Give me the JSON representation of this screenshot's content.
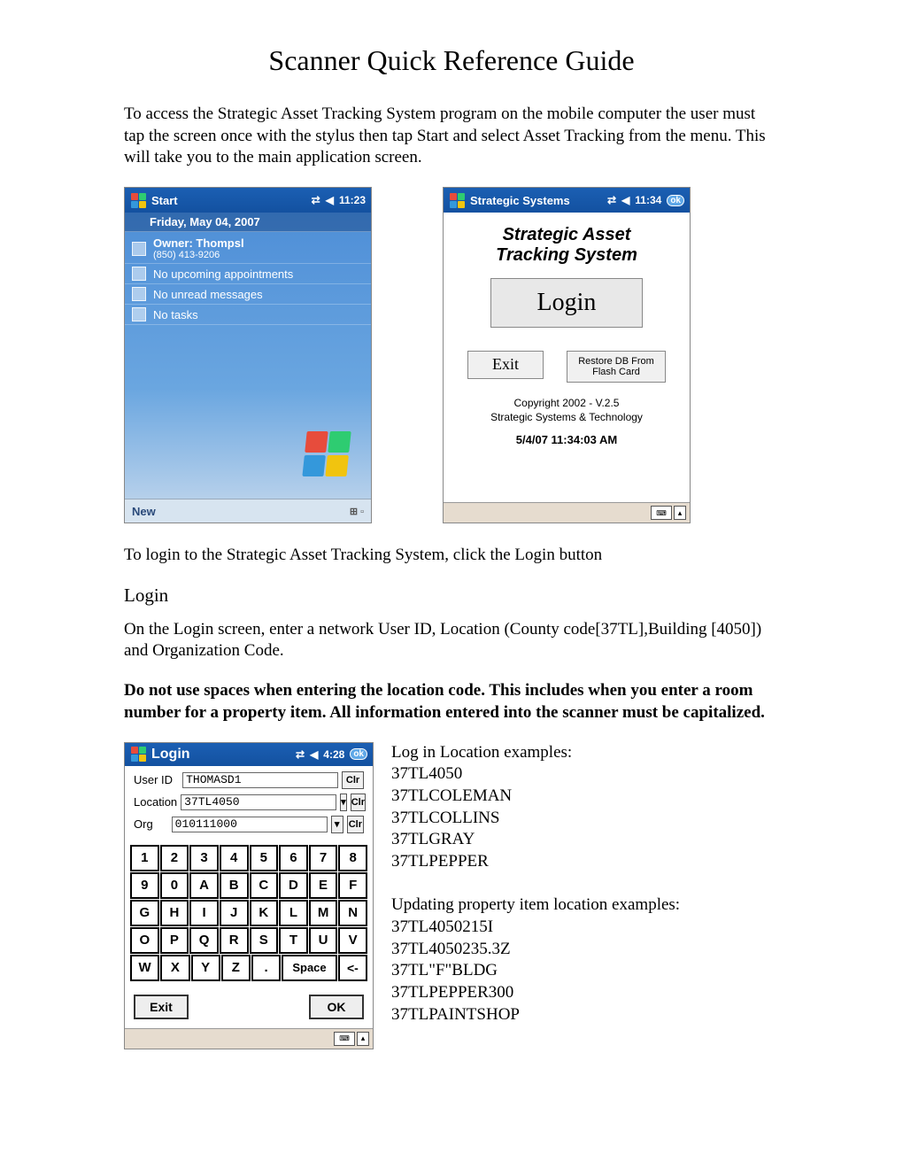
{
  "title": "Scanner Quick Reference Guide",
  "intro": "To access the Strategic Asset Tracking System program on the mobile computer the user must tap the screen once with the stylus then tap Start and select Asset Tracking from the menu.  This will take you to the main application screen.",
  "screenA": {
    "start": "Start",
    "time": "11:23",
    "date": "Friday, May 04, 2007",
    "owner_label": "Owner: Thompsl",
    "owner_phone": "(850) 413-9206",
    "appointments": "No upcoming appointments",
    "messages": "No unread messages",
    "tasks": "No tasks",
    "new": "New"
  },
  "screenB": {
    "title": "Strategic Systems",
    "time": "11:34",
    "ok": "ok",
    "heading1": "Strategic Asset",
    "heading2": "Tracking System",
    "login_btn": "Login",
    "exit_btn": "Exit",
    "restore_btn": "Restore DB From Flash Card",
    "copyright1": "Copyright 2002 - V.2.5",
    "copyright2": "Strategic Systems & Technology",
    "timestamp": "5/4/07 11:34:03 AM"
  },
  "after_screens": "To login to the Strategic Asset Tracking System, click the Login button",
  "login_heading": "Login",
  "login_para": "On the Login screen, enter a network User ID, Location (County code[37TL],Building [4050]) and Organization Code.",
  "bold_para": "Do not use spaces when entering the location code. This includes when you enter a room number for a property item. All information entered into the scanner must be capitalized.",
  "screenC": {
    "title": "Login",
    "time": "4:28",
    "ok": "ok",
    "user_label": "User ID",
    "user_value": "THOMASD1",
    "loc_label": "Location",
    "loc_value": "37TL4050",
    "org_label": "Org",
    "org_value": "010111000",
    "clr": "Clr",
    "keypad": [
      [
        "1",
        "2",
        "3",
        "4",
        "5",
        "6",
        "7",
        "8"
      ],
      [
        "9",
        "0",
        "A",
        "B",
        "C",
        "D",
        "E",
        "F"
      ],
      [
        "G",
        "H",
        "I",
        "J",
        "K",
        "L",
        "M",
        "N"
      ],
      [
        "O",
        "P",
        "Q",
        "R",
        "S",
        "T",
        "U",
        "V"
      ],
      [
        "W",
        "X",
        "Y",
        "Z",
        ".",
        "Space",
        "<-"
      ]
    ],
    "exit": "Exit",
    "ok_btn": "OK"
  },
  "examples": {
    "h1": "Log in Location examples:",
    "list1": [
      "37TL4050",
      "37TLCOLEMAN",
      "37TLCOLLINS",
      "37TLGRAY",
      "37TLPEPPER"
    ],
    "h2": "Updating property item location examples:",
    "list2": [
      "37TL4050215I",
      "37TL4050235.3Z",
      "37TL\"F\"BLDG",
      "37TLPEPPER300",
      "37TLPAINTSHOP"
    ]
  }
}
